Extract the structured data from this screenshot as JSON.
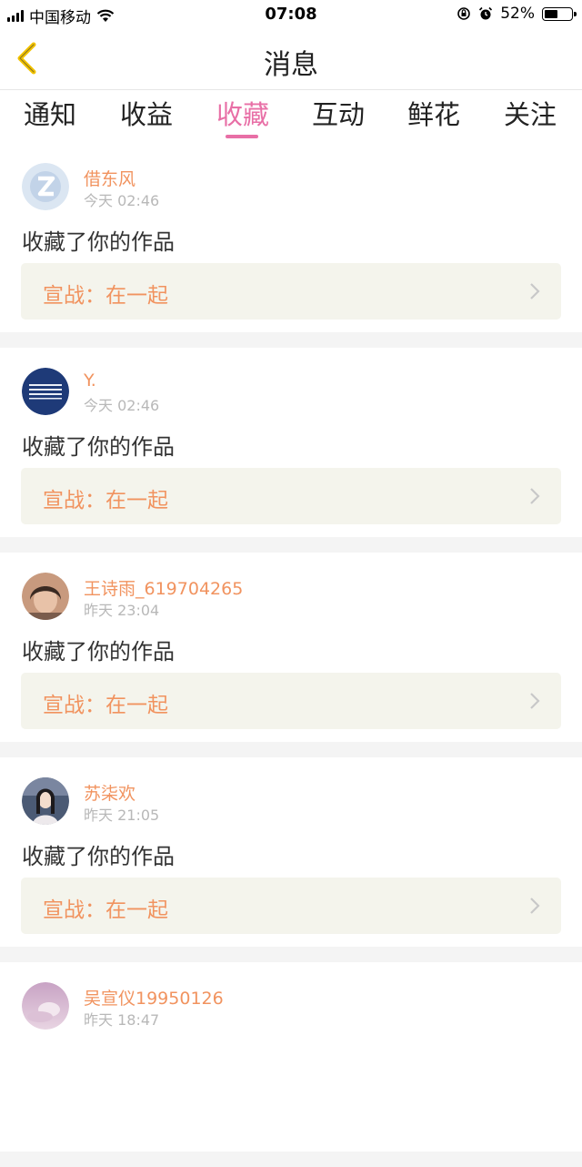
{
  "status_bar": {
    "carrier": "中国移动",
    "time": "07:08",
    "battery_percent": "52%",
    "battery_level": 0.52,
    "icons": [
      "signal-icon",
      "wifi-icon",
      "orientation-lock-icon",
      "alarm-icon",
      "battery-icon"
    ]
  },
  "header": {
    "title": "消息",
    "back_icon": "chevron-left-icon"
  },
  "tabs": [
    {
      "label": "通知"
    },
    {
      "label": "收益"
    },
    {
      "label": "收藏"
    },
    {
      "label": "互动"
    },
    {
      "label": "鲜花"
    },
    {
      "label": "关注"
    }
  ],
  "active_tab": "收藏",
  "colors": {
    "accent": "#e86fa6",
    "name": "#f1935f",
    "work_bg": "#f4f4ec",
    "back_icon": "#f3c300"
  },
  "notifications": [
    {
      "name": "借东风",
      "time": "今天 02:46",
      "message": "收藏了你的作品",
      "work": "宣战：在一起",
      "avatar": "qq-default-avatar"
    },
    {
      "name": "Y.",
      "time": "今天 02:46",
      "message": "收藏了你的作品",
      "work": "宣战：在一起",
      "avatar": "navy-stripes-avatar"
    },
    {
      "name": "王诗雨_619704265",
      "time": "昨天 23:04",
      "message": "收藏了你的作品",
      "work": "宣战：在一起",
      "avatar": "photo-avatar"
    },
    {
      "name": "苏柒欢",
      "time": "昨天 21:05",
      "message": "收藏了你的作品",
      "work": "宣战：在一起",
      "avatar": "photo-avatar"
    },
    {
      "name": "吴宣仪19950126",
      "time": "昨天 18:47",
      "avatar": "photo-avatar"
    }
  ]
}
